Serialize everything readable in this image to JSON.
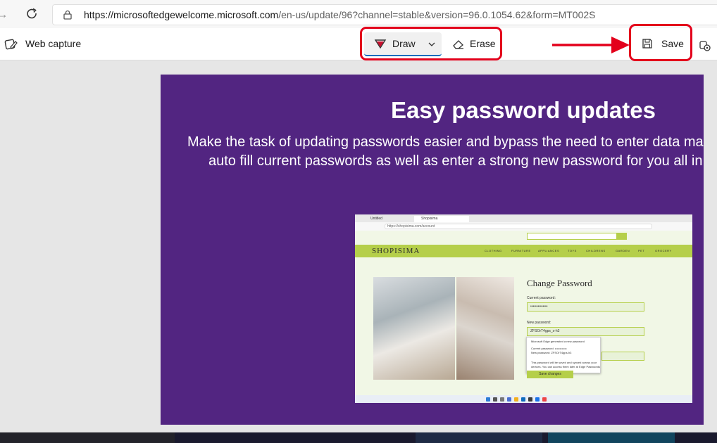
{
  "address_bar": {
    "url_host": "https://microsoftedgewelcome.microsoft.com",
    "url_path": "/en-us/update/96?channel=stable&version=96.0.1054.62&form=MT002S"
  },
  "capture_toolbar": {
    "title": "Web capture",
    "draw_label": "Draw",
    "erase_label": "Erase",
    "save_label": "Save",
    "highlight_color": "#e3001b"
  },
  "hero": {
    "title": "Easy password updates",
    "description_line1": "Make the task of updating passwords easier and bypass the need to enter data mar",
    "description_line2": "auto fill current passwords as well as enter a strong new password for you all in",
    "background_color": "#522581"
  },
  "inner_screenshot": {
    "tab1": "Untitled",
    "tab2": "Shopisima",
    "url": "https://shopisima.com/account",
    "logo": "SHOPISIMA",
    "nav_items": [
      "CLOTHING",
      "FURNITURE",
      "APPLIANCES",
      "TOYS",
      "CHILDRENS",
      "GARDEN",
      "PET",
      "GROCERY"
    ],
    "form_title": "Change Password",
    "current_password_label": "Current password:",
    "current_password_value": "••••••••••••••",
    "new_password_label": "New password:",
    "new_password_value": "ZFSOrT4gps_s-h3",
    "popup_line1": "Microsoft Edge generated a new password",
    "popup_line2": "Current password: ••••••••••••",
    "popup_line3": "New password: ZFSOrT4gps-h3",
    "popup_line4": "This password will be saved and synced across your",
    "popup_line5": "devices. You can access them later at Edge Passwords",
    "save_changes": "Save changes",
    "accent_color": "#b5cf4a"
  }
}
